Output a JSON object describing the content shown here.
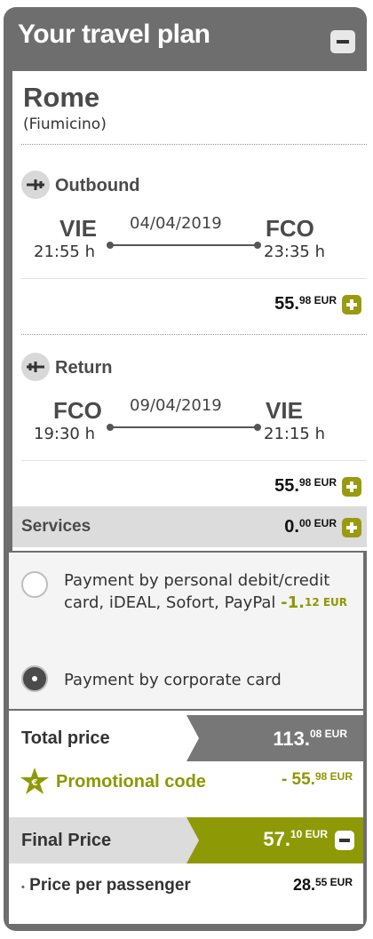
{
  "header": {
    "title": "Your travel plan"
  },
  "destination": {
    "city": "Rome",
    "airport": "(Fiumicino)"
  },
  "outbound": {
    "label": "Outbound",
    "date": "04/04/2019",
    "from_code": "VIE",
    "from_time": "21:55 h",
    "to_code": "FCO",
    "to_time": "23:35 h",
    "price_main": "55.",
    "price_sup": "98 EUR"
  },
  "return": {
    "label": "Return",
    "date": "09/04/2019",
    "from_code": "FCO",
    "from_time": "19:30 h",
    "to_code": "VIE",
    "to_time": "21:15 h",
    "price_main": "55.",
    "price_sup": "98 EUR"
  },
  "services": {
    "label": "Services",
    "price_main": "0.",
    "price_sup": "00 EUR"
  },
  "payment": {
    "option1": {
      "text": "Payment by personal debit/credit card, iDEAL, Sofort, PayPal",
      "discount_main": "-1.",
      "discount_sup": "12 EUR",
      "selected": false
    },
    "option2": {
      "text": "Payment by corporate card",
      "selected": true
    }
  },
  "totals": {
    "total_label": "Total price",
    "total_main": "113.",
    "total_sup": "08 EUR",
    "promo_label": "Promotional code",
    "promo_main": "- 55.",
    "promo_sup": "98 EUR",
    "final_label": "Final Price",
    "final_main": "57.",
    "final_sup": "10 EUR",
    "ppp_label": "Price per passenger",
    "ppp_main": "28.",
    "ppp_sup": "55 EUR"
  },
  "colors": {
    "accent": "#8e9a05",
    "panel": "#6e6e6e",
    "services_bg": "#dcdcdc"
  },
  "icons": [
    "minus-icon",
    "plane-icon",
    "plus-icon",
    "star-icon"
  ]
}
